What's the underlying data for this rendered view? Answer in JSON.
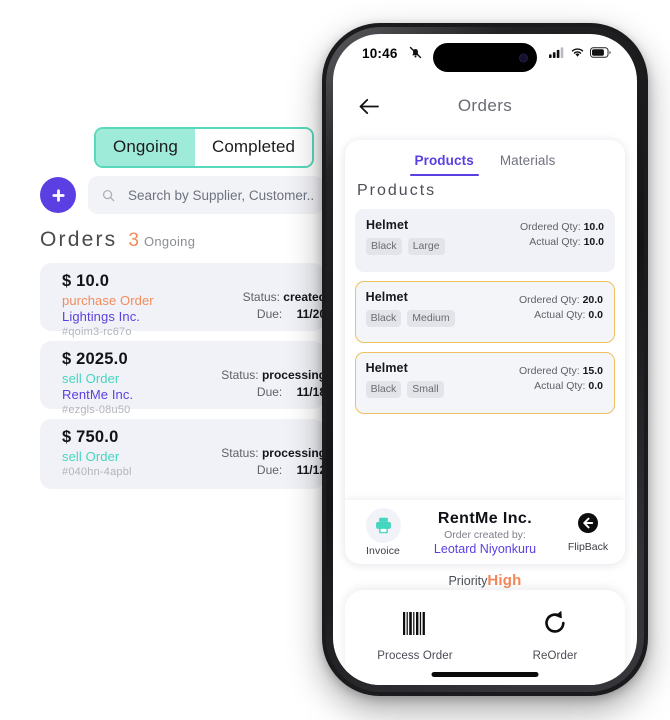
{
  "desktop": {
    "segmented": {
      "ongoing_label": "Ongoing",
      "completed_label": "Completed"
    },
    "add_button_icon": "plus-icon",
    "search": {
      "icon": "search-icon",
      "placeholder": "Search by Supplier, Customer.."
    },
    "heading": {
      "title": "Orders",
      "count": "3",
      "label": "Ongoing"
    },
    "orders": [
      {
        "amount": "$ 10.0",
        "type": "purchase Order",
        "type_kind": "purchase",
        "party": "Lightings Inc.",
        "ref": "#qoim3-rc67o",
        "status_label": "Status:",
        "status_value": "created",
        "due_label": "Due:",
        "due_value": "11/20"
      },
      {
        "amount": "$ 2025.0",
        "type": "sell Order",
        "type_kind": "sell",
        "party": "RentMe Inc.",
        "ref": "#ezgls-08u50",
        "status_label": "Status:",
        "status_value": "processing",
        "due_label": "Due:",
        "due_value": "11/18"
      },
      {
        "amount": "$ 750.0",
        "type": "sell Order",
        "type_kind": "sell",
        "party": "",
        "ref": "#040hn-4apbl",
        "status_label": "Status:",
        "status_value": "processing",
        "due_label": "Due:",
        "due_value": "11/12"
      }
    ]
  },
  "phone": {
    "status_bar": {
      "time": "10:46",
      "mute_icon": "bell-muted-icon",
      "cellular_icon": "cellular-bars-icon",
      "wifi_icon": "wifi-icon",
      "battery_icon": "battery-icon"
    },
    "nav": {
      "back_icon": "arrow-left-icon",
      "title": "Orders"
    },
    "tabs": [
      {
        "label": "Products",
        "active": true
      },
      {
        "label": "Materials",
        "active": false
      }
    ],
    "section_title": "Products",
    "products": [
      {
        "name": "Helmet",
        "tags": [
          "Black",
          "Large"
        ],
        "ordered_label": "Ordered Qty:",
        "ordered_value": "10.0",
        "actual_label": "Actual Qty:",
        "actual_value": "10.0",
        "flagged": false
      },
      {
        "name": "Helmet",
        "tags": [
          "Black",
          "Medium"
        ],
        "ordered_label": "Ordered Qty:",
        "ordered_value": "20.0",
        "actual_label": "Actual Qty:",
        "actual_value": "0.0",
        "flagged": true
      },
      {
        "name": "Helmet",
        "tags": [
          "Black",
          "Small"
        ],
        "ordered_label": "Ordered Qty:",
        "ordered_value": "15.0",
        "actual_label": "Actual Qty:",
        "actual_value": "0.0",
        "flagged": true
      }
    ],
    "footer": {
      "invoice_icon": "printer-icon",
      "invoice_label": "Invoice",
      "company_name": "RentMe Inc.",
      "created_by_label": "Order created by:",
      "created_by_name": "Leotard Niyonkuru",
      "flipback_icon": "arrow-left-circle-icon",
      "flipback_label": "FlipBack"
    },
    "priority": {
      "label": "Priority",
      "value": "High"
    },
    "actions": [
      {
        "icon": "barcode-icon",
        "label": "Process Order"
      },
      {
        "icon": "refresh-icon",
        "label": "ReOrder"
      }
    ]
  },
  "colors": {
    "accent_purple": "#5B3FE2",
    "teal": "#45D6C0",
    "segment_active": "#9FEBD9",
    "orange": "#F28B5B",
    "flag_border": "#F0C060",
    "card_bg": "#F1F2F7"
  }
}
